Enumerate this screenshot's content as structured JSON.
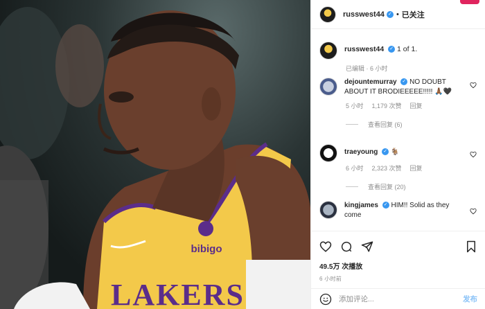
{
  "post": {
    "author": "russwest44",
    "follow_label": "已关注",
    "caption": "1 of 1.",
    "edited_label": "已编辑",
    "edited_time": "6 小时"
  },
  "comments": [
    {
      "user": "dejountemurray",
      "text": "NO DOUBT ABOUT IT BRODIEEEEE!!!!! 🙏🏾🖤",
      "time": "5 小时",
      "likes": "1,179 次赞",
      "reply_label": "回复",
      "view_replies": "查看回复 (6)"
    },
    {
      "user": "traeyoung",
      "text": "🐐",
      "time": "6 小时",
      "likes": "2,323 次赞",
      "reply_label": "回复",
      "view_replies": "查看回复 (20)"
    },
    {
      "user": "kingjames",
      "text": "HIM!! Solid as they come"
    }
  ],
  "stats": {
    "views": "49.5万 次播放",
    "time_ago": "6 小时前"
  },
  "composer": {
    "placeholder": "添加评论...",
    "post_label": "发布"
  },
  "image_text": {
    "brand": "bibigo",
    "team": "LAKERS"
  },
  "colors": {
    "jersey": "#f3c94a",
    "jersey_trim": "#5b2d8a",
    "verified": "#3897f0",
    "post_button": "#8bc3f7"
  }
}
